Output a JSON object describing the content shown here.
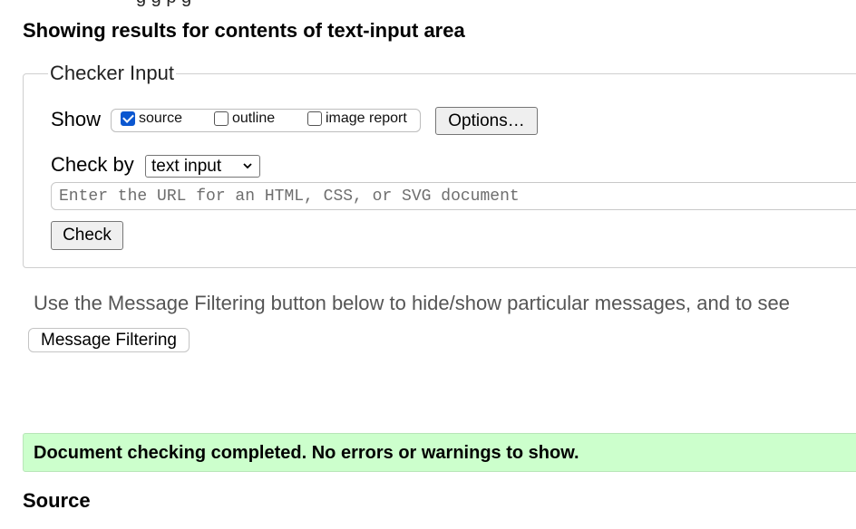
{
  "header": {
    "clipped_top_text": "g g p g",
    "results_heading": "Showing results for contents of text-input area"
  },
  "checker": {
    "legend": "Checker Input",
    "show_label": "Show",
    "options": [
      {
        "label": "source",
        "checked": true
      },
      {
        "label": "outline",
        "checked": false
      },
      {
        "label": "image report",
        "checked": false
      }
    ],
    "options_button": "Options…",
    "check_by_label": "Check by",
    "check_by_value": "text input",
    "url_placeholder": "Enter the URL for an HTML, CSS, or SVG document",
    "check_button": "Check"
  },
  "filtering": {
    "note": "Use the Message Filtering button below to hide/show particular messages, and to see",
    "button": "Message Filtering"
  },
  "result": {
    "message": "Document checking completed. No errors or warnings to show.",
    "color": "#ccffcc"
  },
  "source": {
    "heading": "Source"
  },
  "colors": {
    "checkbox_checked": "#0b57d0"
  }
}
